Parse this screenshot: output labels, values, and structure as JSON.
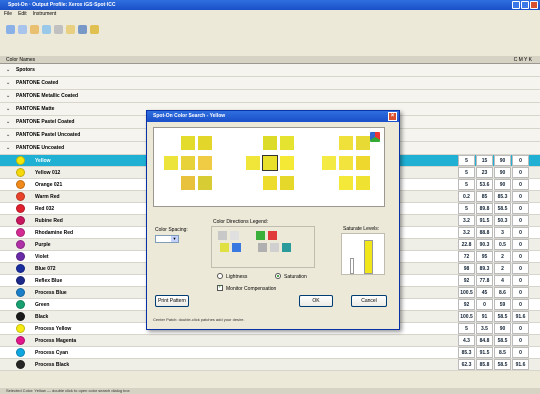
{
  "window": {
    "title": "Spot-On · Output Profile: Xerox iGS·Spot·ICC"
  },
  "menu": [
    "File",
    "Edit",
    "Instrument"
  ],
  "toolbar_icons": [
    "back-icon",
    "forward-icon",
    "search-icon",
    "refresh-icon",
    "print-icon",
    "folder-icon",
    "gear-icon",
    "help-icon"
  ],
  "list_header": {
    "left": "Color Names",
    "right": "C    M    Y    K"
  },
  "groups": [
    "Spotors",
    "PANTONE Coated",
    "PANTONE Metallic Coated",
    "PANTONE Matte",
    "PANTONE Pastel Coated",
    "PANTONE Pastel Uncoated",
    "PANTONE Uncoated"
  ],
  "rows": [
    {
      "name": "Yellow",
      "color": "#f2e80a",
      "vals": [
        "5",
        "15",
        "90",
        "0"
      ],
      "selected": true
    },
    {
      "name": "Yellow 012",
      "color": "#f5d90c",
      "vals": [
        "5",
        "23",
        "90",
        "0"
      ]
    },
    {
      "name": "Orange 021",
      "color": "#f08a1a",
      "vals": [
        "5",
        "53.6",
        "90",
        "0"
      ]
    },
    {
      "name": "Warm Red",
      "color": "#e8422a",
      "vals": [
        "0.2",
        "85",
        "85.3",
        "0"
      ]
    },
    {
      "name": "Red 032",
      "color": "#e1202e",
      "vals": [
        "5",
        "89.8",
        "58.5",
        "0"
      ]
    },
    {
      "name": "Rubine Red",
      "color": "#c8175e",
      "vals": [
        "3.2",
        "91.5",
        "50.3",
        "0"
      ]
    },
    {
      "name": "Rhodamine Red",
      "color": "#d42a94",
      "vals": [
        "3.2",
        "88.8",
        "3",
        "0"
      ]
    },
    {
      "name": "Purple",
      "color": "#b030a8",
      "vals": [
        "22.8",
        "90.3",
        "0.5",
        "0"
      ]
    },
    {
      "name": "Violet",
      "color": "#6a2aa8",
      "vals": [
        "72",
        "95",
        "2",
        "0"
      ]
    },
    {
      "name": "Blue 072",
      "color": "#1a2ea0",
      "vals": [
        "98",
        "89.3",
        "2",
        "0"
      ]
    },
    {
      "name": "Reflex Blue",
      "color": "#1c2a8c",
      "vals": [
        "92",
        "77.8",
        "4",
        "0"
      ]
    },
    {
      "name": "Process Blue",
      "color": "#1a7ec8",
      "vals": [
        "100.5",
        "45",
        "8.6",
        "0"
      ]
    },
    {
      "name": "Green",
      "color": "#18a070",
      "vals": [
        "92",
        "0",
        "59",
        "0"
      ]
    },
    {
      "name": "Black",
      "color": "#1a1a1a",
      "vals": [
        "100.5",
        "91",
        "58.5",
        "91.6"
      ]
    },
    {
      "name": "Process Yellow",
      "color": "#f7ea10",
      "vals": [
        "5",
        "3.5",
        "90",
        "0"
      ]
    },
    {
      "name": "Process Magenta",
      "color": "#e0168a",
      "vals": [
        "4.3",
        "84.8",
        "58.5",
        "0"
      ]
    },
    {
      "name": "Process Cyan",
      "color": "#10a6e0",
      "vals": [
        "85.3",
        "91.5",
        "8.5",
        "0"
      ]
    },
    {
      "name": "Process Black",
      "color": "#262626",
      "vals": [
        "62.3",
        "85.8",
        "58.5",
        "91.6"
      ]
    }
  ],
  "status": "Selected Color: Yellow — double click to open color search dialog box",
  "dialog": {
    "title": "Spot-On Color Search - Yellow",
    "spacing_label": "Color Spacing:",
    "spacing_value": "",
    "legend_label": "Color Directions Legend:",
    "levels_label": "Saturate Levels:",
    "lightness_label": "Lightness",
    "saturation_label": "Saturation",
    "lightness_on": false,
    "saturation_on": true,
    "monitor_label": "Monitor Compensation",
    "monitor_on": true,
    "print_button": "Print Pattern",
    "ok_button": "OK",
    "cancel_button": "Cancel",
    "hint": "Center Patch: double-click patches add your desire."
  },
  "preview_colors": {
    "left": [
      "#e4dc2c",
      "#e2d62a",
      "#ece43a",
      "#e8d23a",
      "#f0cc44",
      "#e8c23c",
      "#d8cc34"
    ],
    "center": [
      "#dcdc28",
      "#e6e230",
      "#f0e63a",
      "#e8e02a",
      "#f4ea36",
      "#eedc2c",
      "#e6d82a"
    ],
    "right": [
      "#f0e03a",
      "#e8da34",
      "#f4ea44",
      "#f2e43c",
      "#eed82e",
      "#f4e838",
      "#f0e230"
    ]
  },
  "legend_colors": [
    "#c8c8c8",
    "#e0e0e0",
    "#3ab03a",
    "#e03a3a",
    "#e0e040",
    "#3a7ae0",
    "#b0b0b0",
    "#d0d0d0",
    "#2a9a9a"
  ]
}
